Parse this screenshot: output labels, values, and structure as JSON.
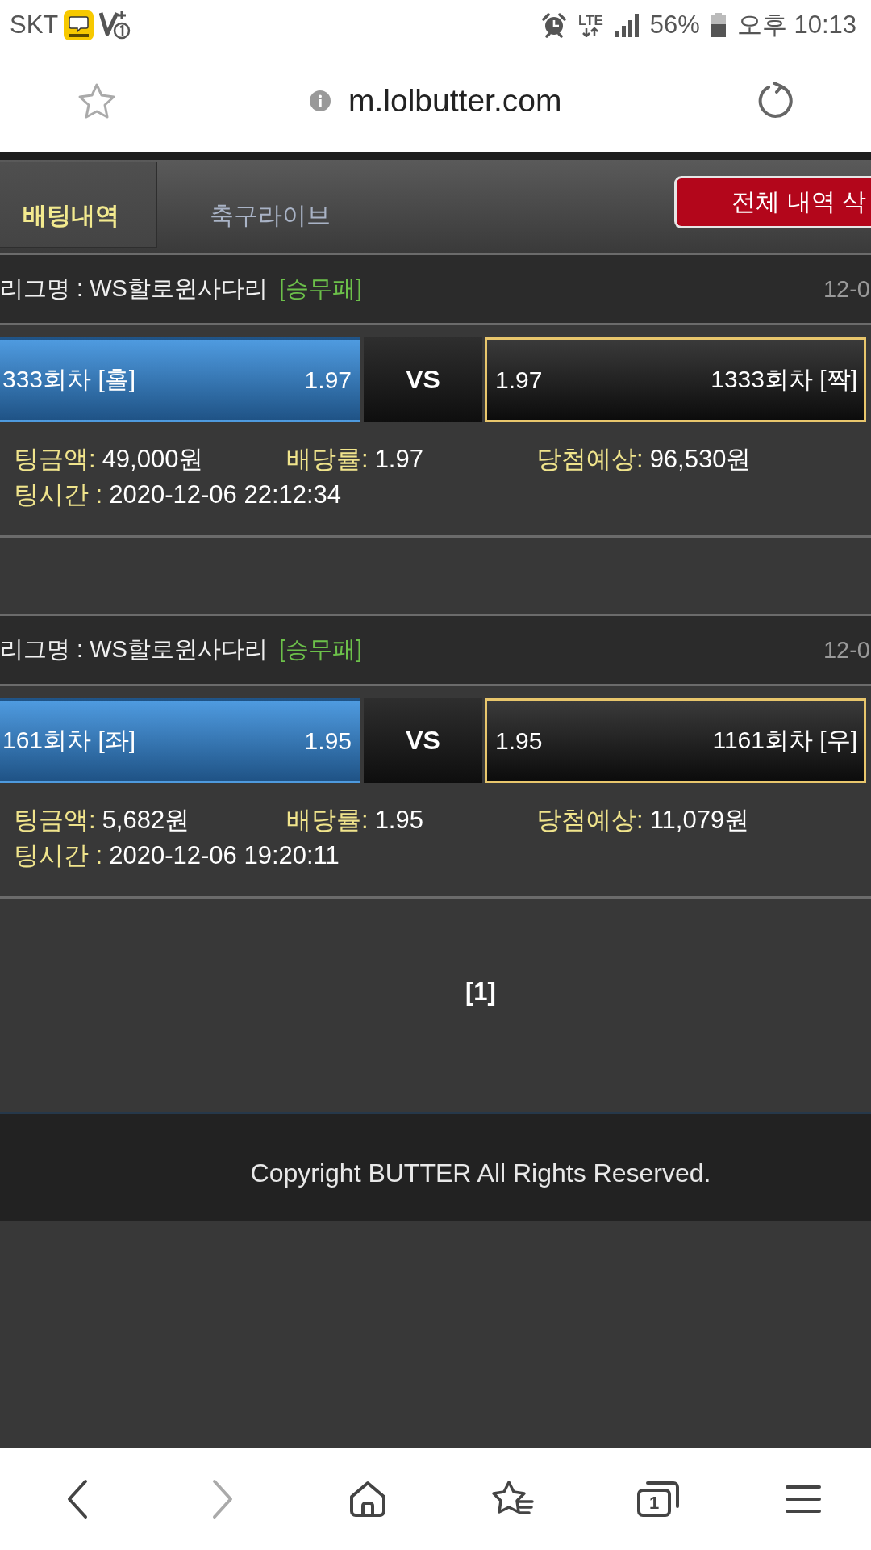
{
  "status_bar": {
    "carrier": "SKT",
    "network": "LTE",
    "battery": "56%",
    "time": "오후 10:13"
  },
  "address_bar": {
    "url": "m.lolbutter.com"
  },
  "tabs": [
    {
      "label": "배팅내역",
      "selected": true
    },
    {
      "label": "축구라이브",
      "selected": false
    }
  ],
  "delete_all_button": "전체 내역 삭",
  "bets": [
    {
      "league": "리그명 : WS할로윈사다리",
      "market": "[승무패]",
      "date": "12-0",
      "options": [
        {
          "kind": "home",
          "name": "333회차 [홀]",
          "odds": "1.97",
          "selected": false
        },
        {
          "kind": "away",
          "name": "1333회차 [짝]",
          "odds": "1.97",
          "selected": true
        }
      ],
      "vs": "VS",
      "details": [
        {
          "label": "팅금액:",
          "value": "49,000원"
        },
        {
          "label": "배당률:",
          "value": "1.97"
        },
        {
          "label": "당첨예상:",
          "value": "96,530원"
        }
      ],
      "bet_time": {
        "label": "팅시간 :",
        "value": "2020-12-06 22:12:34"
      }
    },
    {
      "league": "리그명 : WS할로윈사다리",
      "market": "[승무패]",
      "date": "12-0",
      "options": [
        {
          "kind": "home",
          "name": "161회차 [좌]",
          "odds": "1.95",
          "selected": false
        },
        {
          "kind": "away",
          "name": "1161회차 [우]",
          "odds": "1.95",
          "selected": true
        }
      ],
      "vs": "VS",
      "details": [
        {
          "label": "팅금액:",
          "value": "5,682원"
        },
        {
          "label": "배당률:",
          "value": "1.95"
        },
        {
          "label": "당첨예상:",
          "value": "11,079원"
        }
      ],
      "bet_time": {
        "label": "팅시간 :",
        "value": "2020-12-06 19:20:11"
      }
    }
  ],
  "pagination": [
    "[1]"
  ],
  "footer": {
    "copyright": "Copyright BUTTER All Rights Reserved."
  },
  "bottom_nav": [
    {
      "kind": "back",
      "disabled": false
    },
    {
      "kind": "forward",
      "disabled": true
    },
    {
      "kind": "home",
      "disabled": false
    },
    {
      "kind": "bookmarks",
      "disabled": false
    },
    {
      "kind": "tabs",
      "disabled": false,
      "count": "1"
    },
    {
      "kind": "menu",
      "disabled": false
    }
  ]
}
